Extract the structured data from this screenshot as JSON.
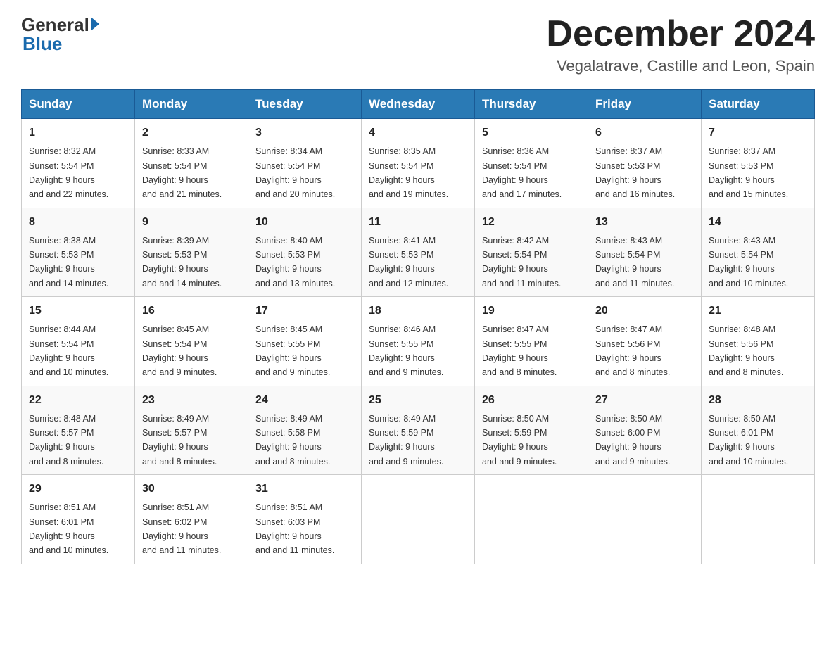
{
  "header": {
    "logo_general": "General",
    "logo_blue": "Blue",
    "month_title": "December 2024",
    "location": "Vegalatrave, Castille and Leon, Spain"
  },
  "weekdays": [
    "Sunday",
    "Monday",
    "Tuesday",
    "Wednesday",
    "Thursday",
    "Friday",
    "Saturday"
  ],
  "weeks": [
    [
      {
        "day": "1",
        "sunrise": "8:32 AM",
        "sunset": "5:54 PM",
        "daylight": "9 hours and 22 minutes."
      },
      {
        "day": "2",
        "sunrise": "8:33 AM",
        "sunset": "5:54 PM",
        "daylight": "9 hours and 21 minutes."
      },
      {
        "day": "3",
        "sunrise": "8:34 AM",
        "sunset": "5:54 PM",
        "daylight": "9 hours and 20 minutes."
      },
      {
        "day": "4",
        "sunrise": "8:35 AM",
        "sunset": "5:54 PM",
        "daylight": "9 hours and 19 minutes."
      },
      {
        "day": "5",
        "sunrise": "8:36 AM",
        "sunset": "5:54 PM",
        "daylight": "9 hours and 17 minutes."
      },
      {
        "day": "6",
        "sunrise": "8:37 AM",
        "sunset": "5:53 PM",
        "daylight": "9 hours and 16 minutes."
      },
      {
        "day": "7",
        "sunrise": "8:37 AM",
        "sunset": "5:53 PM",
        "daylight": "9 hours and 15 minutes."
      }
    ],
    [
      {
        "day": "8",
        "sunrise": "8:38 AM",
        "sunset": "5:53 PM",
        "daylight": "9 hours and 14 minutes."
      },
      {
        "day": "9",
        "sunrise": "8:39 AM",
        "sunset": "5:53 PM",
        "daylight": "9 hours and 14 minutes."
      },
      {
        "day": "10",
        "sunrise": "8:40 AM",
        "sunset": "5:53 PM",
        "daylight": "9 hours and 13 minutes."
      },
      {
        "day": "11",
        "sunrise": "8:41 AM",
        "sunset": "5:53 PM",
        "daylight": "9 hours and 12 minutes."
      },
      {
        "day": "12",
        "sunrise": "8:42 AM",
        "sunset": "5:54 PM",
        "daylight": "9 hours and 11 minutes."
      },
      {
        "day": "13",
        "sunrise": "8:43 AM",
        "sunset": "5:54 PM",
        "daylight": "9 hours and 11 minutes."
      },
      {
        "day": "14",
        "sunrise": "8:43 AM",
        "sunset": "5:54 PM",
        "daylight": "9 hours and 10 minutes."
      }
    ],
    [
      {
        "day": "15",
        "sunrise": "8:44 AM",
        "sunset": "5:54 PM",
        "daylight": "9 hours and 10 minutes."
      },
      {
        "day": "16",
        "sunrise": "8:45 AM",
        "sunset": "5:54 PM",
        "daylight": "9 hours and 9 minutes."
      },
      {
        "day": "17",
        "sunrise": "8:45 AM",
        "sunset": "5:55 PM",
        "daylight": "9 hours and 9 minutes."
      },
      {
        "day": "18",
        "sunrise": "8:46 AM",
        "sunset": "5:55 PM",
        "daylight": "9 hours and 9 minutes."
      },
      {
        "day": "19",
        "sunrise": "8:47 AM",
        "sunset": "5:55 PM",
        "daylight": "9 hours and 8 minutes."
      },
      {
        "day": "20",
        "sunrise": "8:47 AM",
        "sunset": "5:56 PM",
        "daylight": "9 hours and 8 minutes."
      },
      {
        "day": "21",
        "sunrise": "8:48 AM",
        "sunset": "5:56 PM",
        "daylight": "9 hours and 8 minutes."
      }
    ],
    [
      {
        "day": "22",
        "sunrise": "8:48 AM",
        "sunset": "5:57 PM",
        "daylight": "9 hours and 8 minutes."
      },
      {
        "day": "23",
        "sunrise": "8:49 AM",
        "sunset": "5:57 PM",
        "daylight": "9 hours and 8 minutes."
      },
      {
        "day": "24",
        "sunrise": "8:49 AM",
        "sunset": "5:58 PM",
        "daylight": "9 hours and 8 minutes."
      },
      {
        "day": "25",
        "sunrise": "8:49 AM",
        "sunset": "5:59 PM",
        "daylight": "9 hours and 9 minutes."
      },
      {
        "day": "26",
        "sunrise": "8:50 AM",
        "sunset": "5:59 PM",
        "daylight": "9 hours and 9 minutes."
      },
      {
        "day": "27",
        "sunrise": "8:50 AM",
        "sunset": "6:00 PM",
        "daylight": "9 hours and 9 minutes."
      },
      {
        "day": "28",
        "sunrise": "8:50 AM",
        "sunset": "6:01 PM",
        "daylight": "9 hours and 10 minutes."
      }
    ],
    [
      {
        "day": "29",
        "sunrise": "8:51 AM",
        "sunset": "6:01 PM",
        "daylight": "9 hours and 10 minutes."
      },
      {
        "day": "30",
        "sunrise": "8:51 AM",
        "sunset": "6:02 PM",
        "daylight": "9 hours and 11 minutes."
      },
      {
        "day": "31",
        "sunrise": "8:51 AM",
        "sunset": "6:03 PM",
        "daylight": "9 hours and 11 minutes."
      },
      null,
      null,
      null,
      null
    ]
  ]
}
